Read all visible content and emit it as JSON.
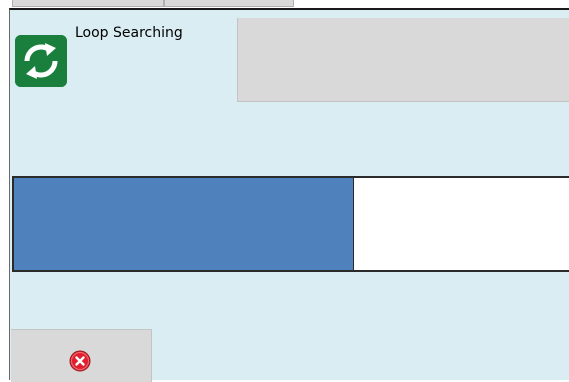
{
  "dialog": {
    "title": "Loop Searching",
    "icon": "refresh-loop-icon",
    "progress": 0.612
  },
  "cancel_button": {
    "icon": "close-icon"
  },
  "colors": {
    "background": "#daedf3",
    "progress_fill": "#4f81bd",
    "icon_bg": "#1a7f3c",
    "panel": "#d9d9d9",
    "close_red": "#e0202f"
  }
}
